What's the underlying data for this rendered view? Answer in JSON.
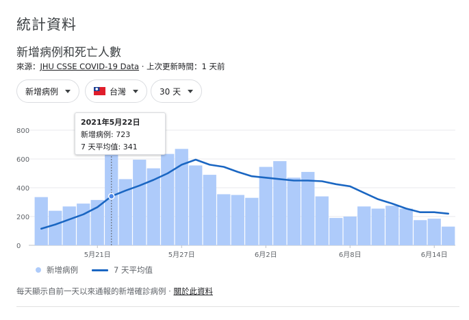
{
  "page_title": "統計資料",
  "section_title": "新增病例和死亡人數",
  "source": {
    "prefix": "來源：",
    "link": "JHU CSSE COVID-19 Data",
    "updated": " · 上次更新時間：1 天前"
  },
  "filters": {
    "metric": "新增病例",
    "region": "台灣",
    "region_flag_icon": "taiwan-flag-icon",
    "range": "30 天"
  },
  "tooltip": {
    "date": "2021年5月22日",
    "cases": "新增病例: 723",
    "avg": "7 天平均值: 341"
  },
  "legend": {
    "bars": "新增病例",
    "line": "7 天平均值"
  },
  "footer": {
    "text": "每天顯示自前一天以來通報的新增確診病例 · ",
    "link": "關於此資料"
  },
  "colors": {
    "bar": "#aecbfa",
    "line": "#1a66c2",
    "grid": "#e8eaed",
    "text": "#5f6368"
  },
  "chart_data": {
    "type": "bar",
    "ylim": [
      0,
      800
    ],
    "yticks": [
      0,
      200,
      400,
      600,
      800
    ],
    "categories": [
      "5月17日",
      "5月18日",
      "5月19日",
      "5月20日",
      "5月21日",
      "5月22日",
      "5月23日",
      "5月24日",
      "5月25日",
      "5月26日",
      "5月27日",
      "5月28日",
      "5月29日",
      "5月30日",
      "5月31日",
      "6月1日",
      "6月2日",
      "6月3日",
      "6月4日",
      "6月5日",
      "6月6日",
      "6月7日",
      "6月8日",
      "6月9日",
      "6月10日",
      "6月11日",
      "6月12日",
      "6月13日",
      "6月14日",
      "6月15日"
    ],
    "xtick_labels": [
      {
        "index": 4,
        "label": "5月21日"
      },
      {
        "index": 10,
        "label": "5月27日"
      },
      {
        "index": 16,
        "label": "6月2日"
      },
      {
        "index": 22,
        "label": "6月8日"
      },
      {
        "index": 28,
        "label": "6月14日"
      }
    ],
    "highlight_index": 5,
    "series": [
      {
        "name": "新增病例",
        "type": "bar",
        "values": [
          335,
          240,
          270,
          290,
          315,
          723,
          460,
          595,
          535,
          635,
          670,
          555,
          490,
          355,
          350,
          330,
          545,
          585,
          470,
          510,
          340,
          190,
          200,
          270,
          255,
          275,
          255,
          175,
          185,
          130
        ]
      },
      {
        "name": "7 天平均值",
        "type": "line",
        "values": [
          115,
          145,
          180,
          215,
          265,
          341,
          380,
          415,
          455,
          500,
          560,
          595,
          560,
          545,
          510,
          480,
          470,
          460,
          450,
          450,
          445,
          425,
          410,
          365,
          320,
          290,
          255,
          230,
          230,
          220
        ]
      }
    ]
  }
}
